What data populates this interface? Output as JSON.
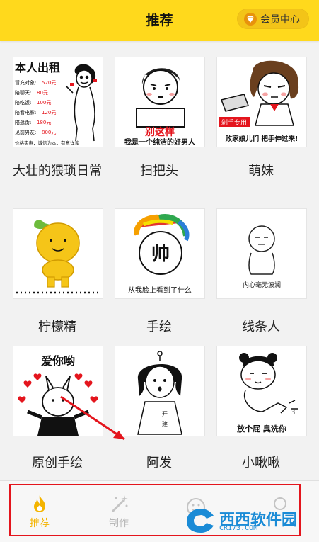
{
  "header": {
    "title": "推荐",
    "vip_label": "会员中心"
  },
  "cards": [
    {
      "label": "大壮的猥琐日常",
      "art": {
        "title": "本人出租",
        "lines": [
          "冒充对象:",
          "520元",
          "陪聊天:",
          "80元",
          "陪吃饭:",
          "100元",
          "陪看电影:",
          "120元",
          "陪逛街:",
          "180元",
          "见前男友:",
          "800元"
        ],
        "footer": "价格实惠，诚信为本，有意详谈"
      }
    },
    {
      "label": "扫把头",
      "art": {
        "caption1": "别这样",
        "caption2": "我是一个纯洁的好男人"
      }
    },
    {
      "label": "萌妹",
      "art": {
        "tag": "剁手专用",
        "caption": "败家娘儿们 把手伸过来!"
      }
    },
    {
      "label": "柠檬精"
    },
    {
      "label": "手绘",
      "art": {
        "face_text": "帅",
        "caption": "从我脸上看到了什么"
      }
    },
    {
      "label": "线条人",
      "art": {
        "caption": "内心毫无波澜"
      }
    },
    {
      "label": "原创手绘",
      "art": {
        "caption": "爱你哟"
      }
    },
    {
      "label": "阿发"
    },
    {
      "label": "小啾啾",
      "art": {
        "caption": "放个屁 臭洗你"
      }
    }
  ],
  "tabs": [
    {
      "label": "推荐",
      "icon": "flame-icon",
      "active": true
    },
    {
      "label": "制作",
      "icon": "magic-wand-icon",
      "active": false
    }
  ],
  "watermark": {
    "text": "西西软件园",
    "sub": "CR173.COM"
  },
  "colors": {
    "accent": "#ffd91c",
    "highlight_frame": "#e4151d",
    "tab_active": "#f4b400"
  }
}
